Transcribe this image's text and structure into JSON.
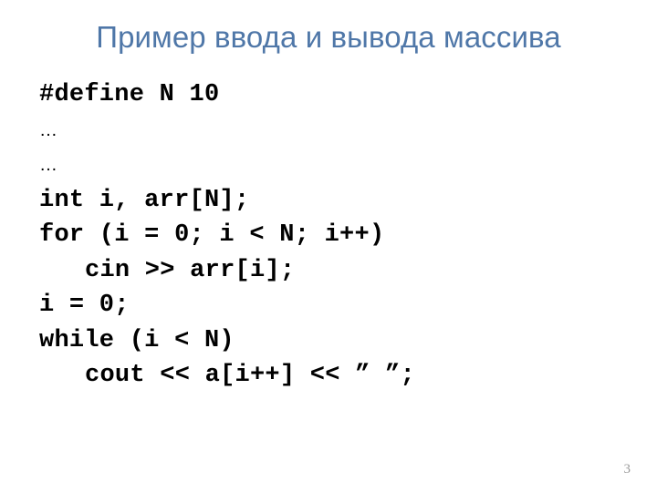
{
  "slide": {
    "title": "Пример ввода и вывода массива",
    "title_color": "#4f77a8",
    "background_color": "#ffffff",
    "number": "3",
    "number_color": "#9a9a9a",
    "code_color": "#000000",
    "code_lines": [
      {
        "text": "#define N 10",
        "indent": false,
        "style": "code"
      },
      {
        "text": "…",
        "indent": false,
        "style": "ellipsis"
      },
      {
        "text": "…",
        "indent": false,
        "style": "ellipsis"
      },
      {
        "text": "int i, arr[N];",
        "indent": false,
        "style": "code"
      },
      {
        "text": "for (i = 0; i < N; i++)",
        "indent": false,
        "style": "code"
      },
      {
        "text": "cin >> arr[i];",
        "indent": true,
        "style": "code"
      },
      {
        "text": "i = 0;",
        "indent": false,
        "style": "code"
      },
      {
        "text": "while (i < N)",
        "indent": false,
        "style": "code"
      },
      {
        "text": "cout << a[i++] << ” ”;",
        "indent": true,
        "style": "code"
      }
    ]
  }
}
